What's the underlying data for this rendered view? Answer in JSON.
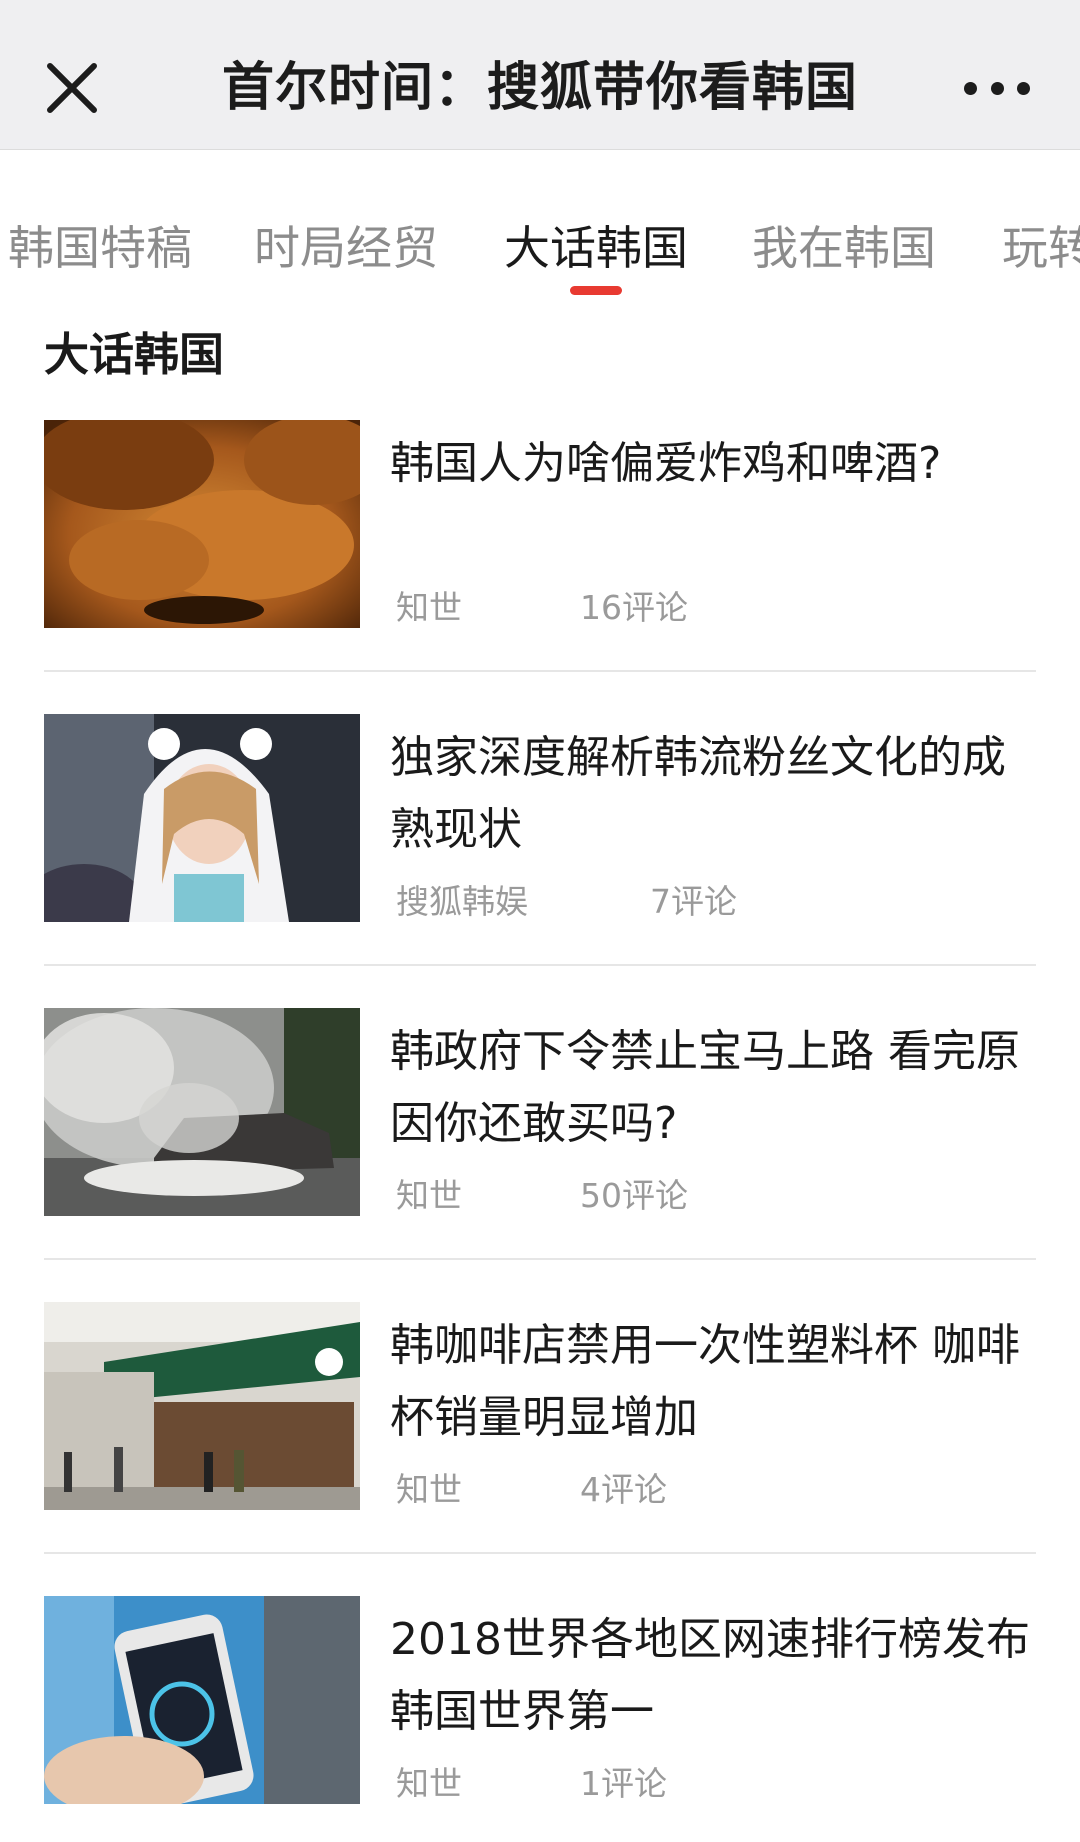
{
  "header": {
    "title": "首尔时间：搜狐带你看韩国",
    "close_icon": "close-icon",
    "more_icon": "more-horizontal-icon"
  },
  "tabs": [
    {
      "label": "韩国特稿",
      "active": false
    },
    {
      "label": "时局经贸",
      "active": false
    },
    {
      "label": "大话韩国",
      "active": true
    },
    {
      "label": "我在韩国",
      "active": false
    },
    {
      "label": "玩转",
      "active": false
    }
  ],
  "accent_color": "#e83a31",
  "section": {
    "title": "大话韩国"
  },
  "articles": [
    {
      "headline": "韩国人为啥偏爱炸鸡和啤酒?",
      "source": "知世",
      "comments": "16评论",
      "image": "fried-chicken-photo"
    },
    {
      "headline": "独家深度解析韩流粉丝文化的成熟现状",
      "source": "搜狐韩娱",
      "comments": "7评论",
      "image": "idol-photo"
    },
    {
      "headline": "韩政府下令禁止宝马上路 看完原因你还敢买吗?",
      "source": "知世",
      "comments": "50评论",
      "image": "burning-car-photo"
    },
    {
      "headline": "韩咖啡店禁用一次性塑料杯 咖啡杯销量明显增加",
      "source": "知世",
      "comments": "4评论",
      "image": "starbucks-store-photo"
    },
    {
      "headline": "2018世界各地区网速排行榜发布 韩国世界第一",
      "source": "知世",
      "comments": "1评论",
      "image": "speedtest-phone-photo"
    }
  ]
}
